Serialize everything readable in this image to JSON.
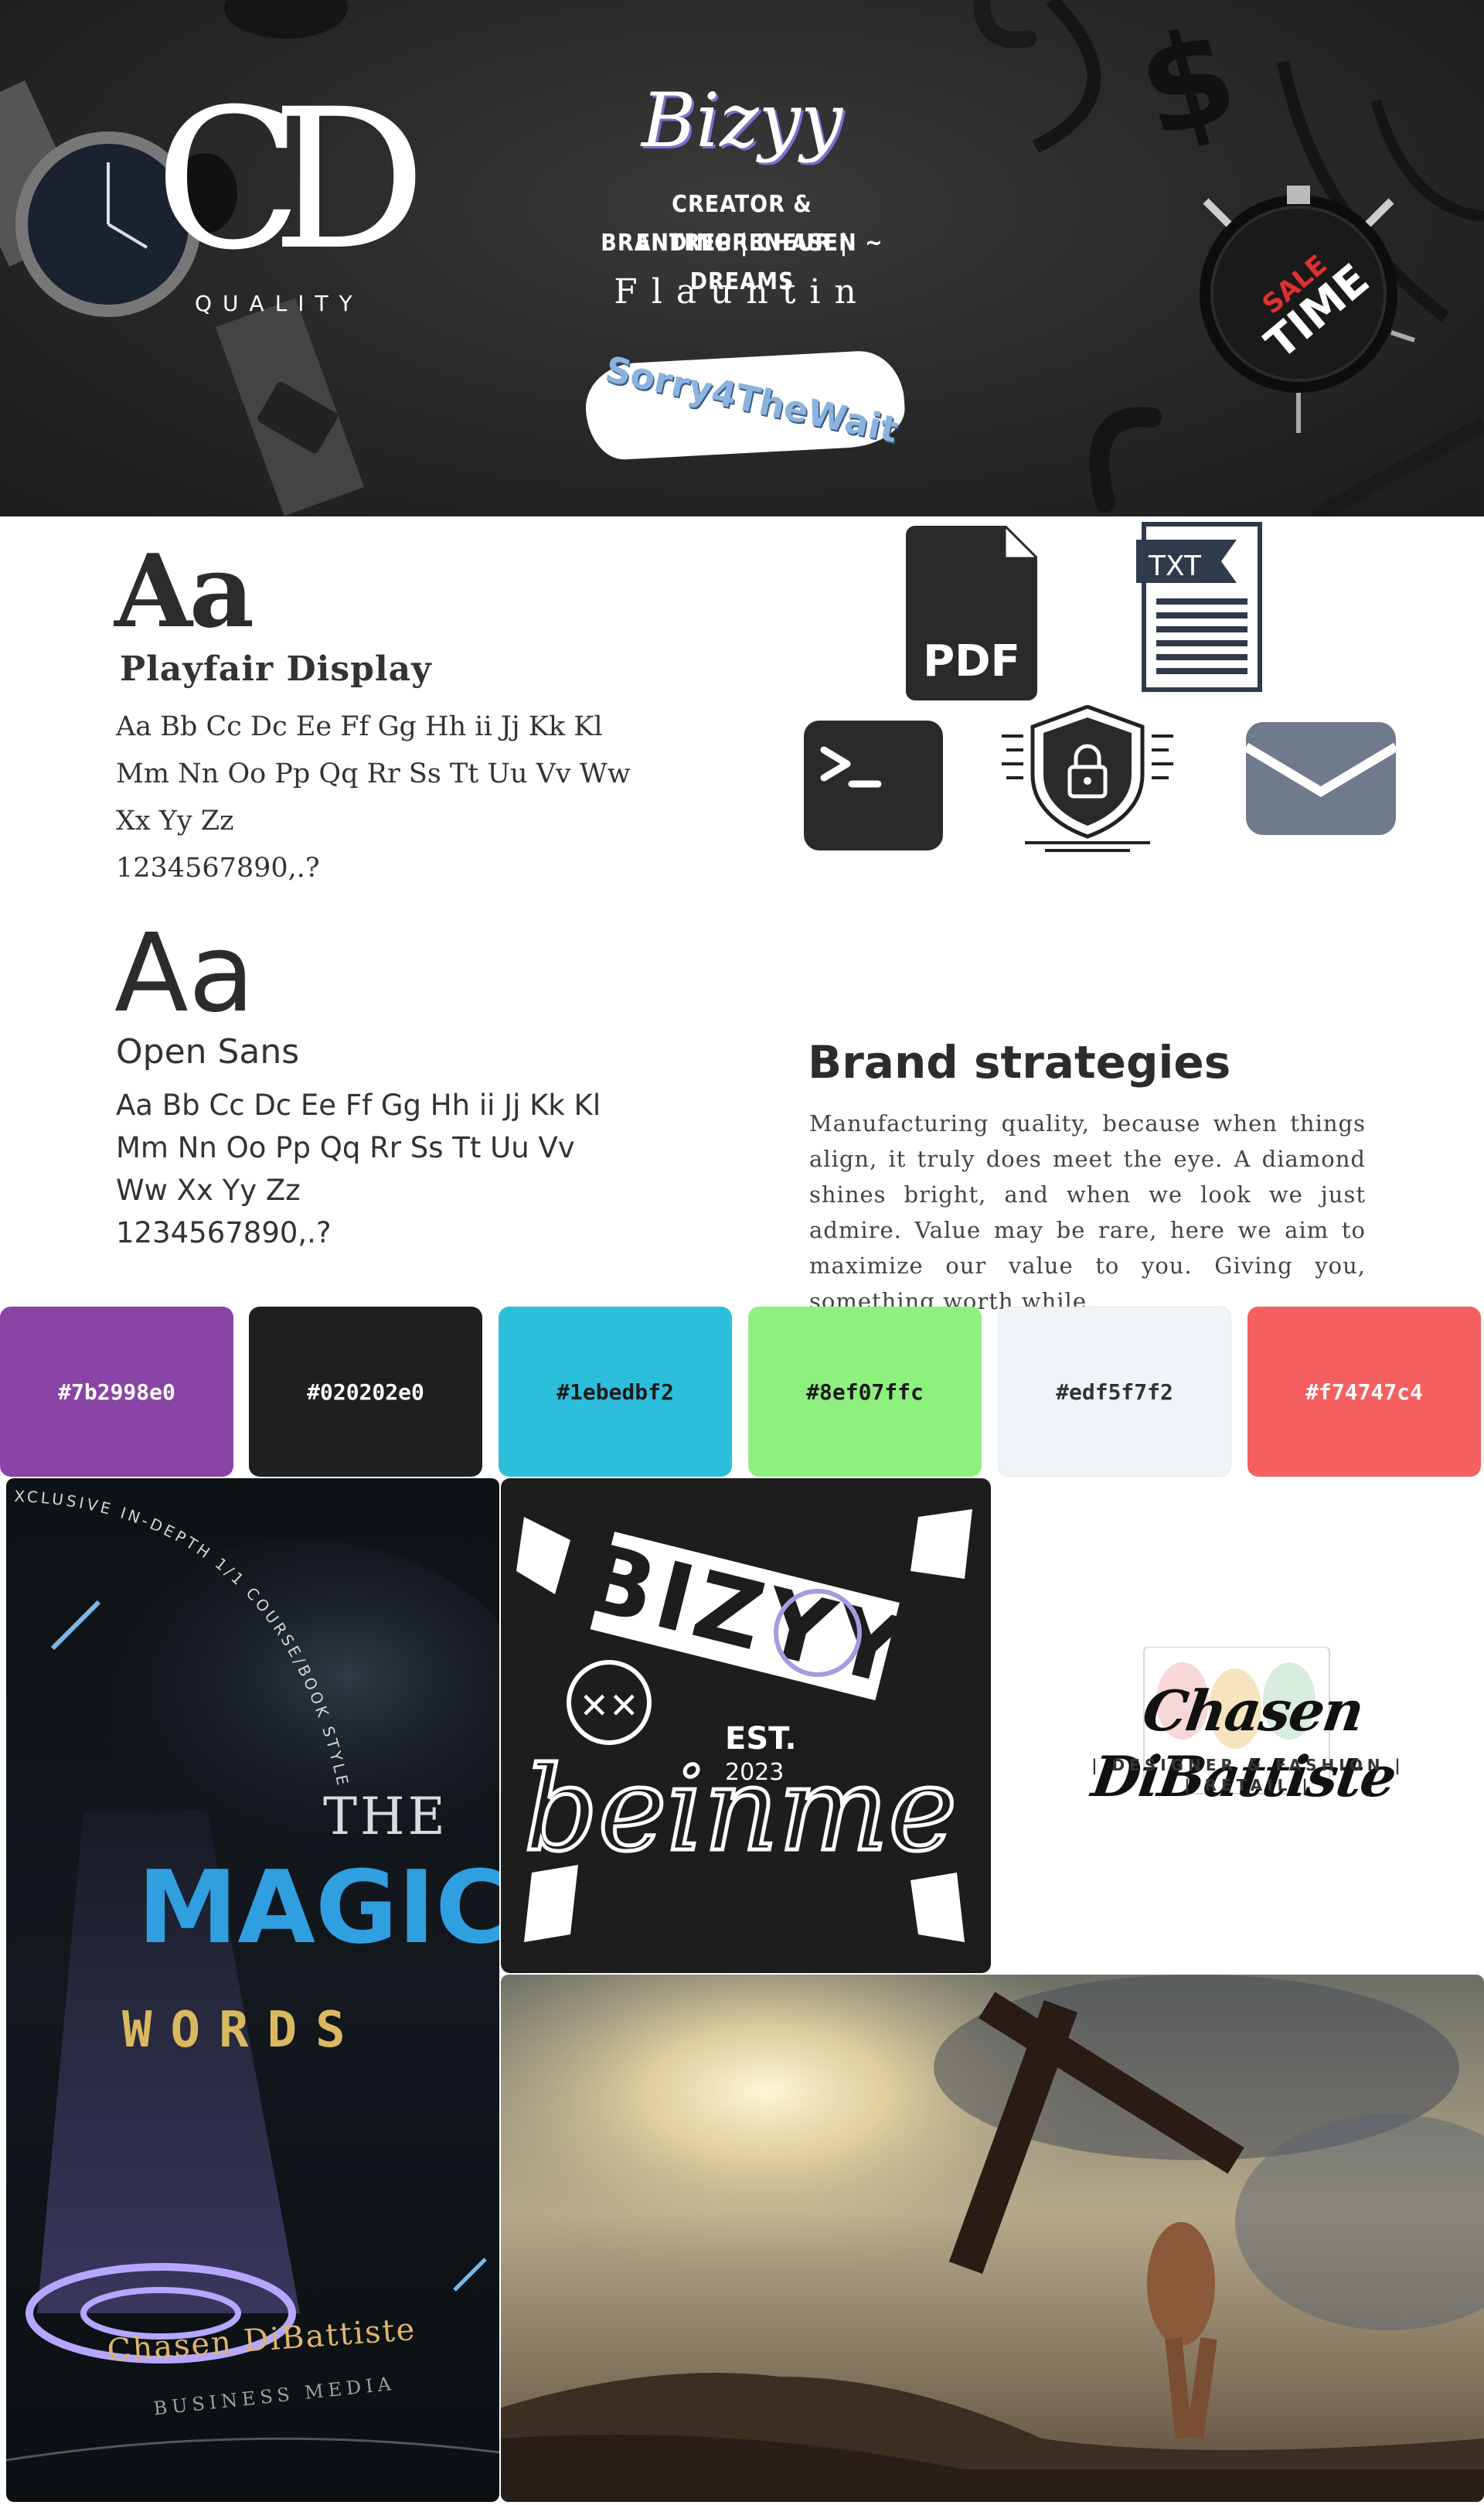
{
  "hero": {
    "logo_letters": "CD",
    "logo_caption": "QUALITY",
    "brand_script": "Bizyy",
    "tagline_line1": "CREATOR & ENTREPRENEUR |",
    "tagline_line2": "BRANDING | CHASEN ~ DREAMS",
    "flaunt": "Flauntin",
    "badge_text": "Sorry4TheWait",
    "clock_text_1": "SALE",
    "clock_text_2": "TIME",
    "clock_sale_color": "#e03030"
  },
  "typography": {
    "serif": {
      "specimen": "Aa",
      "font_name": "Playfair Display",
      "line1": "Aa Bb Cc Dc Ee Ff Gg Hh ii Jj Kk Kl",
      "line2": "Mm Nn Oo Pp Qq Rr Ss Tt Uu Vv Ww",
      "line3": "Xx Yy Zz",
      "line4": "1234567890,.?"
    },
    "sans": {
      "specimen": "Aa",
      "font_name": "Open Sans",
      "line1": "Aa Bb Cc Dc Ee Ff Gg Hh ii Jj Kk Kl",
      "line2": "Mm Nn Oo Pp Qq Rr Ss Tt Uu Vv",
      "line3": "Ww Xx Yy Zz",
      "line4": "1234567890,.?"
    }
  },
  "icons": {
    "pdf_label": "PDF",
    "txt_label": "TXT",
    "items": [
      "pdf-icon",
      "txt-file-icon",
      "terminal-icon",
      "shield-lock-icon",
      "mail-icon"
    ],
    "icon_dark": "#2a2a2a",
    "icon_mail": "#6f7a8c"
  },
  "brand": {
    "heading": "Brand strategies",
    "body": "Manufacturing quality, because when things align, it truly does meet the eye. A diamond shines bright, and when we look we just admire. Value may be rare, here we aim to maximize our value to you. Giving you, something worth while."
  },
  "palette": [
    {
      "hex": "#7b2998e0",
      "color": "#8a44a5",
      "text_color": "#ffffff"
    },
    {
      "hex": "#020202e0",
      "color": "#1f1f1f",
      "text_color": "#ffffff"
    },
    {
      "hex": "#1ebedbf2",
      "color": "#2bbfdc",
      "text_color": "#1a1a1a"
    },
    {
      "hex": "#8ef07ffc",
      "color": "#8ef07f",
      "text_color": "#1a1a1a"
    },
    {
      "hex": "#edf5f7f2",
      "color": "#eef4f7",
      "text_color": "#333333"
    },
    {
      "hex": "#f74747c4",
      "color": "#f65f5f",
      "text_color": "#ffffff"
    }
  ],
  "gallery": {
    "magic": {
      "arc_text": "XCLUSIVE IN-DEPTH 1/1 COURSE/BOOK STYLE",
      "the": "THE",
      "magic": "MAGIC",
      "words": "WORDS",
      "author": "Chasen DiBattiste",
      "sub": "BUSINESS MEDIA",
      "magic_color": "#2f9fe0",
      "words_color": "#d9b860"
    },
    "bizyy": {
      "brand": "BIZYY",
      "est": "EST.",
      "year": "2023",
      "tagline": "beinme"
    },
    "chasen": {
      "name": "Chasen DiBattiste",
      "line1": "| DESIGNER & FASHION |",
      "line2": "| RETAIL |"
    }
  }
}
